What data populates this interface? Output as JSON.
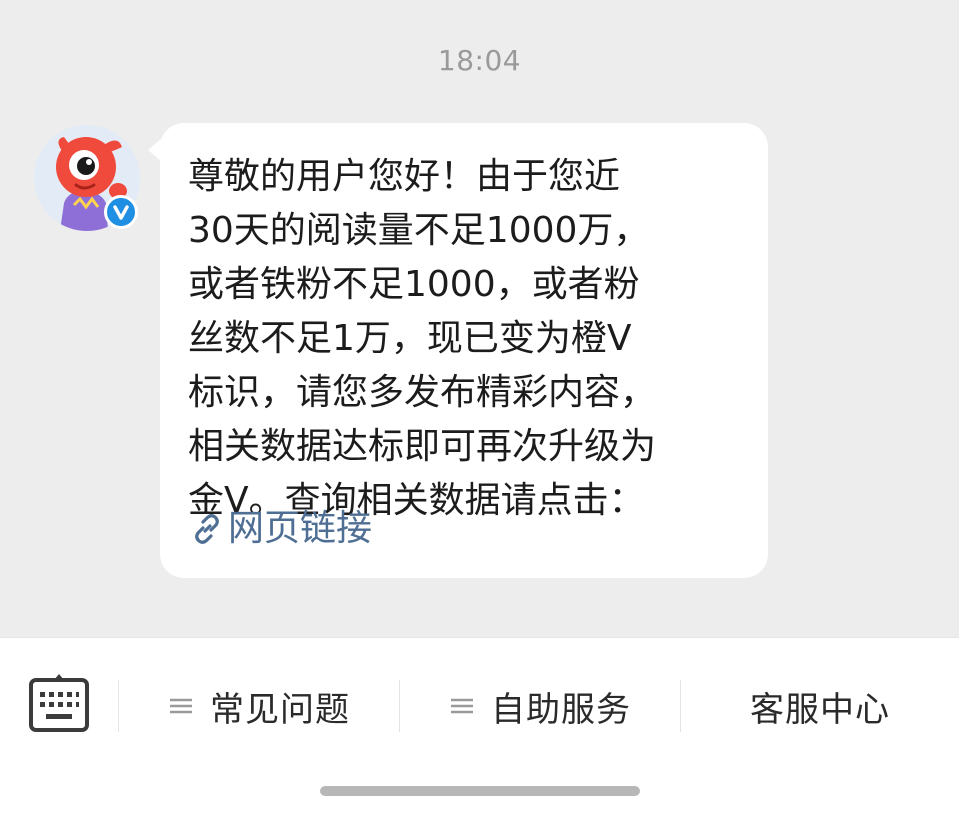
{
  "chat": {
    "timestamp": "18:04",
    "sender": {
      "avatar": "red-mascot-avatar",
      "badge_icon": "verified-v-icon",
      "badge_letter": "V"
    },
    "message": {
      "lines": [
        "尊敬的用户您好！由于您近",
        "30天的阅读量不足1000万，",
        "或者铁粉不足1000，或者粉",
        "丝数不足1万，现已变为橙V",
        "标识，请您多发布精彩内容，",
        "相关数据达标即可再次升级为",
        "金V。查询相关数据请点击："
      ],
      "link": {
        "icon": "link-icon",
        "label": "网页链接"
      }
    }
  },
  "bottom_bar": {
    "keyboard_icon": "keyboard-icon",
    "menu_icon": "menu-lines-icon",
    "buttons": [
      {
        "label": "常见问题",
        "has_menu_icon": true
      },
      {
        "label": "自助服务",
        "has_menu_icon": true
      },
      {
        "label": "客服中心",
        "has_menu_icon": false
      }
    ]
  },
  "colors": {
    "chat_background": "#ededed",
    "bubble": "#ffffff",
    "link": "#4e6e93",
    "verified_badge": "#1f8fe3",
    "timestamp": "#9a9a9a"
  }
}
